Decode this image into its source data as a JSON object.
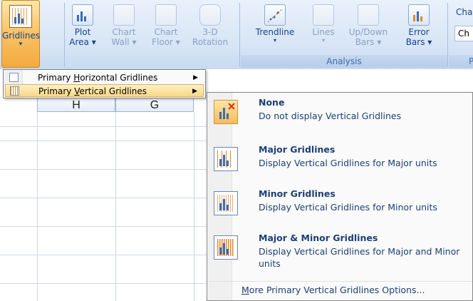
{
  "ribbon": {
    "gridlines": {
      "label": "Gridlines",
      "arrow": "▾"
    },
    "background_group": [
      {
        "id": "plot-area",
        "line1": "Plot",
        "line2": "Area ▾"
      },
      {
        "id": "chart-wall",
        "line1": "Chart",
        "line2": "Wall ▾"
      },
      {
        "id": "chart-floor",
        "line1": "Chart",
        "line2": "Floor ▾"
      },
      {
        "id": "3d-rotation",
        "line1": "3-D",
        "line2": "Rotation"
      }
    ],
    "analysis_group": [
      {
        "id": "trendline",
        "line1": "Trendline",
        "line2": "▾"
      },
      {
        "id": "lines",
        "line1": "Lines",
        "line2": "▾"
      },
      {
        "id": "up-down-bars",
        "line1": "Up/Down",
        "line2": "Bars ▾"
      },
      {
        "id": "error-bars",
        "line1": "Error",
        "line2": "Bars ▾"
      }
    ],
    "analysis_label": "Analysis",
    "properties_top": "Cha",
    "properties_field": "Ch",
    "properties_label": "P"
  },
  "sheet": {
    "columns": [
      "H",
      "G"
    ]
  },
  "submenu": {
    "items": [
      {
        "pre": "Primary ",
        "ul": "H",
        "post": "orizontal Gridlines",
        "chevron": "▶"
      },
      {
        "pre": "Primary ",
        "ul": "V",
        "post": "ertical Gridlines",
        "chevron": "▶"
      }
    ]
  },
  "menu": {
    "items": [
      {
        "title": "None",
        "desc": "Do not display Vertical Gridlines"
      },
      {
        "title": "Major Gridlines",
        "desc": "Display Vertical Gridlines for Major units"
      },
      {
        "title": "Minor Gridlines",
        "desc": "Display Vertical Gridlines for Minor units"
      },
      {
        "title": "Major & Minor Gridlines",
        "desc": "Display Vertical Gridlines for Major and Minor units"
      }
    ],
    "footer_ul": "M",
    "footer_rest": "ore Primary Vertical Gridlines Options..."
  },
  "colors": {
    "highlight": "#f9d987",
    "ribbon": "#d6e4f5",
    "bar": "#3a6db5",
    "grid_accent": "#e08a2a"
  }
}
